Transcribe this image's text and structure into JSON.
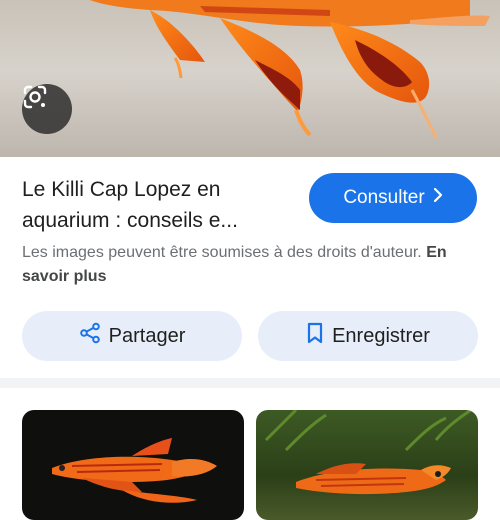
{
  "result": {
    "title": "Le Killi Cap Lopez en aquarium : conseils e...",
    "visit_label": "Consulter",
    "copyright_notice": "Les images peuvent être soumises à des droits d'auteur.",
    "learn_more_label": "En savoir plus"
  },
  "actions": {
    "share_label": "Partager",
    "save_label": "Enregistrer"
  },
  "icons": {
    "lens": "google-lens-icon",
    "visit": "chevron-right-icon",
    "share": "share-icon",
    "save": "bookmark-icon"
  },
  "colors": {
    "accent": "#1a73e8",
    "pill_bg": "#e8eef9"
  }
}
